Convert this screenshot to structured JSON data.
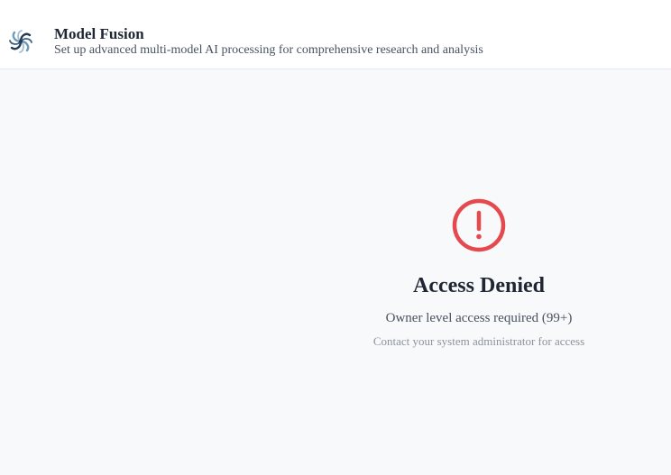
{
  "header": {
    "logo_icon": "spiral-logo-icon",
    "title": "Model Fusion",
    "subtitle": "Set up advanced multi-model AI processing for comprehensive research and analysis"
  },
  "access_denied": {
    "icon": "alert-circle-icon",
    "icon_color": "#e5484d",
    "title": "Access Denied",
    "message": "Owner level access required (99+)",
    "hint": "Contact your system administrator for access"
  }
}
